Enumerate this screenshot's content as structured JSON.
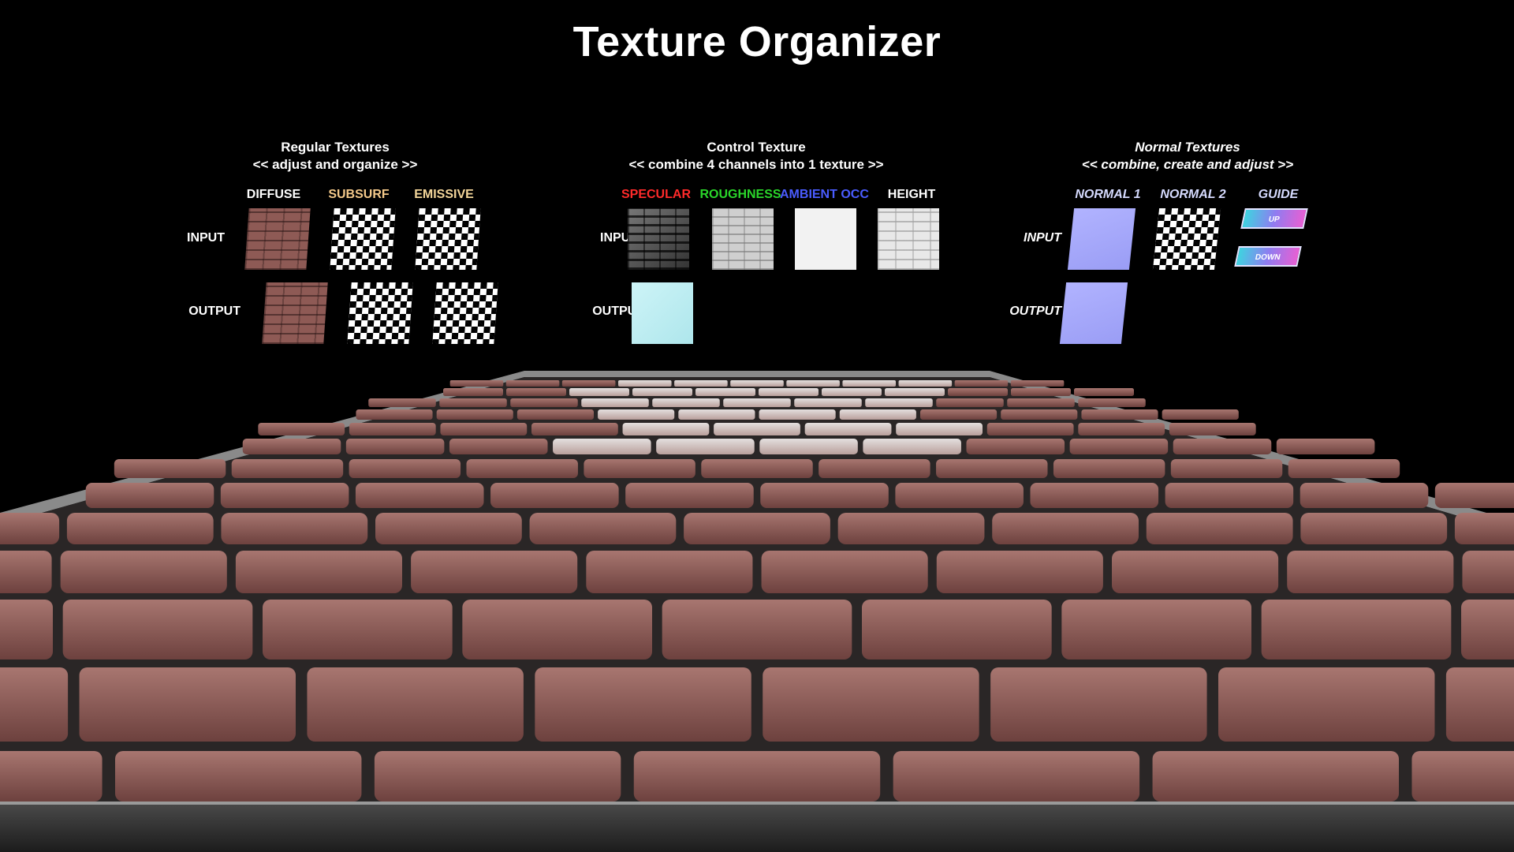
{
  "title": "Texture Organizer",
  "panels": {
    "regular": {
      "title": "Regular Textures",
      "subtitle": "<< adjust and organize >>",
      "rows": [
        "INPUT",
        "OUTPUT"
      ],
      "channels": [
        {
          "label": "DIFFUSE",
          "color": "#ffffff"
        },
        {
          "label": "SUBSURF",
          "color": "#f4c98a"
        },
        {
          "label": "EMISSIVE",
          "color": "#f4d69a"
        }
      ]
    },
    "control": {
      "title": "Control Texture",
      "subtitle": "<< combine 4 channels into 1 texture >>",
      "rows": [
        "INPUT",
        "OUTPUT"
      ],
      "channels": [
        {
          "label": "SPECULAR",
          "color": "#ff2a2a"
        },
        {
          "label": "ROUGHNESS",
          "color": "#2ad62a"
        },
        {
          "label": "AMBIENT OCC",
          "color": "#4a5cff"
        },
        {
          "label": "HEIGHT",
          "color": "#ffffff"
        }
      ]
    },
    "normal": {
      "title": "Normal Textures",
      "subtitle": "<< combine, create and adjust >>",
      "rows": [
        "INPUT",
        "OUTPUT"
      ],
      "channels": [
        {
          "label": "NORMAL 1",
          "color": "#d6dbff"
        },
        {
          "label": "NORMAL 2",
          "color": "#d6dbff"
        },
        {
          "label": "GUIDE",
          "color": "#d6dbff"
        }
      ],
      "buttons": {
        "up": "UP",
        "down": "DOWN"
      }
    }
  },
  "colors": {
    "background": "#000000",
    "brick": "#8e5a55",
    "mortar": "#2a2a2a",
    "frame": "#9a9a9a"
  }
}
